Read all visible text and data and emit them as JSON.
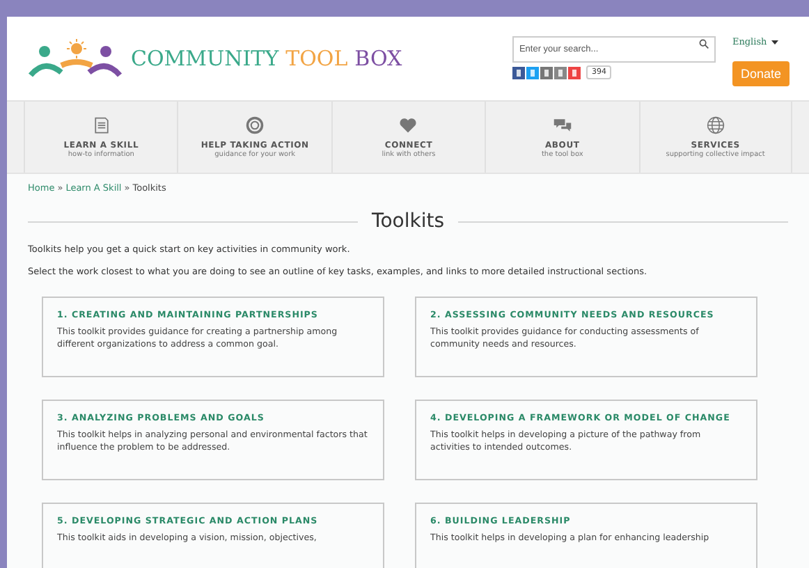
{
  "logo": {
    "words": [
      {
        "text": "COMMUNITY",
        "color": "#3aa98a"
      },
      {
        "text": "TOOL",
        "color": "#f2a444"
      },
      {
        "text": "BOX",
        "color": "#7d4fa3"
      }
    ]
  },
  "search": {
    "placeholder": "Enter your search..."
  },
  "language": {
    "label": "English"
  },
  "share_count": "394",
  "donate": "Donate",
  "nav": [
    {
      "label": "LEARN A SKILL",
      "sub": "how-to information"
    },
    {
      "label": "HELP TAKING ACTION",
      "sub": "guidance for your work"
    },
    {
      "label": "CONNECT",
      "sub": "link with others"
    },
    {
      "label": "ABOUT",
      "sub": "the tool box"
    },
    {
      "label": "SERVICES",
      "sub": "supporting collective impact"
    }
  ],
  "breadcrumb_separator": "»",
  "breadcrumb": [
    {
      "label": "Home",
      "link": true
    },
    {
      "label": "Learn A Skill",
      "link": true
    },
    {
      "label": "Toolkits",
      "link": false
    }
  ],
  "title": "Toolkits",
  "intro": [
    "Toolkits help you get a quick start on key activities in community work.",
    "Select the work closest to what you are doing to see an outline of key tasks, examples, and links to more detailed instructional sections."
  ],
  "toolkits": [
    {
      "title": "1. CREATING AND MAINTAINING PARTNERSHIPS",
      "text": "This toolkit provides guidance for creating a partnership among different organizations to address a common goal."
    },
    {
      "title": "2. ASSESSING COMMUNITY NEEDS AND RESOURCES",
      "text": "This toolkit provides guidance for conducting assessments of community needs and resources."
    },
    {
      "title": "3. ANALYZING PROBLEMS AND GOALS",
      "text": "This toolkit helps in analyzing personal and environmental factors that influence the problem to be addressed."
    },
    {
      "title": "4. DEVELOPING A FRAMEWORK OR MODEL OF CHANGE",
      "text": "This toolkit helps in developing a picture of the pathway from activities to intended outcomes."
    },
    {
      "title": "5. DEVELOPING STRATEGIC AND ACTION PLANS",
      "text": "This toolkit aids in developing a vision, mission, objectives,"
    },
    {
      "title": "6. BUILDING LEADERSHIP",
      "text": "This toolkit helps in developing a plan for enhancing leadership"
    }
  ]
}
